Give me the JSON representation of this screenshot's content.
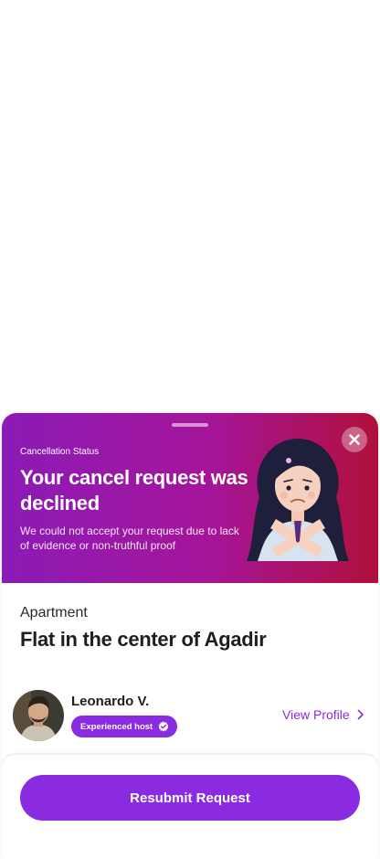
{
  "sheet": {
    "hero": {
      "status_label": "Cancellation Status",
      "title": "Your cancel request was declined",
      "description": "We could not accept your request due to lack of evidence or non-truthful proof",
      "close_icon": "close-icon",
      "illustration": "woman-crossing-arms-illustration"
    },
    "listing": {
      "category": "Apartment",
      "title": "Flat in the center of Agadir"
    },
    "host": {
      "name": "Leonardo V.",
      "badge": "Experienced host",
      "badge_icon": "verified-check-icon",
      "view_profile_label": "View Profile",
      "view_profile_icon": "chevron-right-icon"
    },
    "footer": {
      "resubmit_label": "Resubmit Request"
    }
  },
  "colors": {
    "accent": "#8a2be2",
    "hero_gradient_start": "#8b1bb6",
    "hero_gradient_end": "#b0103a"
  }
}
